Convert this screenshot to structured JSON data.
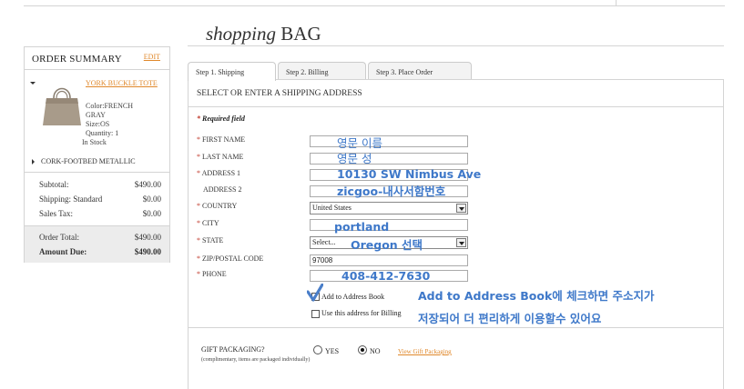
{
  "page": {
    "title_italic": "shopping",
    "title_caps": "BAG"
  },
  "summary": {
    "title": "ORDER SUMMARY",
    "edit_label": "EDIT",
    "item1": {
      "name": "YORK BUCKLE TOTE",
      "color": "Color:FRENCH GRAY",
      "size": "Size:OS",
      "quantity": "Quantity: 1",
      "stock": "In Stock"
    },
    "item2": {
      "name": "CORK-FOOTBED METALLIC"
    },
    "rows": [
      {
        "label": "Subtotal:",
        "value": "$490.00"
      },
      {
        "label": "Shipping: Standard",
        "value": "$0.00"
      },
      {
        "label": "Sales Tax:",
        "value": "$0.00"
      }
    ],
    "order_total": {
      "label": "Order Total:",
      "value": "$490.00"
    },
    "amount_due": {
      "label": "Amount Due:",
      "value": "$490.00"
    }
  },
  "tabs": [
    {
      "label": "Step 1. Shipping",
      "active": true
    },
    {
      "label": "Step 2. Billing",
      "active": false
    },
    {
      "label": "Step 3. Place Order",
      "active": false
    }
  ],
  "form": {
    "header": "SELECT OR ENTER A SHIPPING ADDRESS",
    "required_note": "Required field",
    "required_star": "*",
    "first_name_label": "FIRST NAME",
    "last_name_label": "LAST NAME",
    "address1_label": "ADDRESS 1",
    "address2_label": "ADDRESS 2",
    "country_label": "COUNTRY",
    "country_value": "United States",
    "city_label": "CITY",
    "state_label": "STATE",
    "state_value": "Select...",
    "zip_label": "ZIP/POSTAL CODE",
    "zip_value": "97008",
    "phone_label": "PHONE",
    "add_to_book_label": "Add to Address Book",
    "add_to_book_checked": true,
    "use_for_billing_label": "Use this address for Billing",
    "use_for_billing_checked": false,
    "gift_label": "GIFT PACKAGING?",
    "gift_sub": "(complimentary, items are packaged individually)",
    "gift_yes": "YES",
    "gift_no": "NO",
    "gift_selected": "NO",
    "view_gift": "View Gift Packaging"
  },
  "annotations": {
    "first_name": "영문 이름",
    "last_name": "영문 성",
    "address1": "10130 SW Nimbus Ave",
    "address2": "zicgoo-내사서함번호",
    "city": "portland",
    "state": "Oregon 선택",
    "phone": "408-412-7630",
    "tip_line1": "Add to Address Book에 체크하면 주소지가",
    "tip_line2": "저장되어 더 편리하게 이용할수 있어요"
  },
  "colors": {
    "link_orange": "#e0882b",
    "annotation_blue": "#3e78c9",
    "required_red": "#c0392b"
  }
}
